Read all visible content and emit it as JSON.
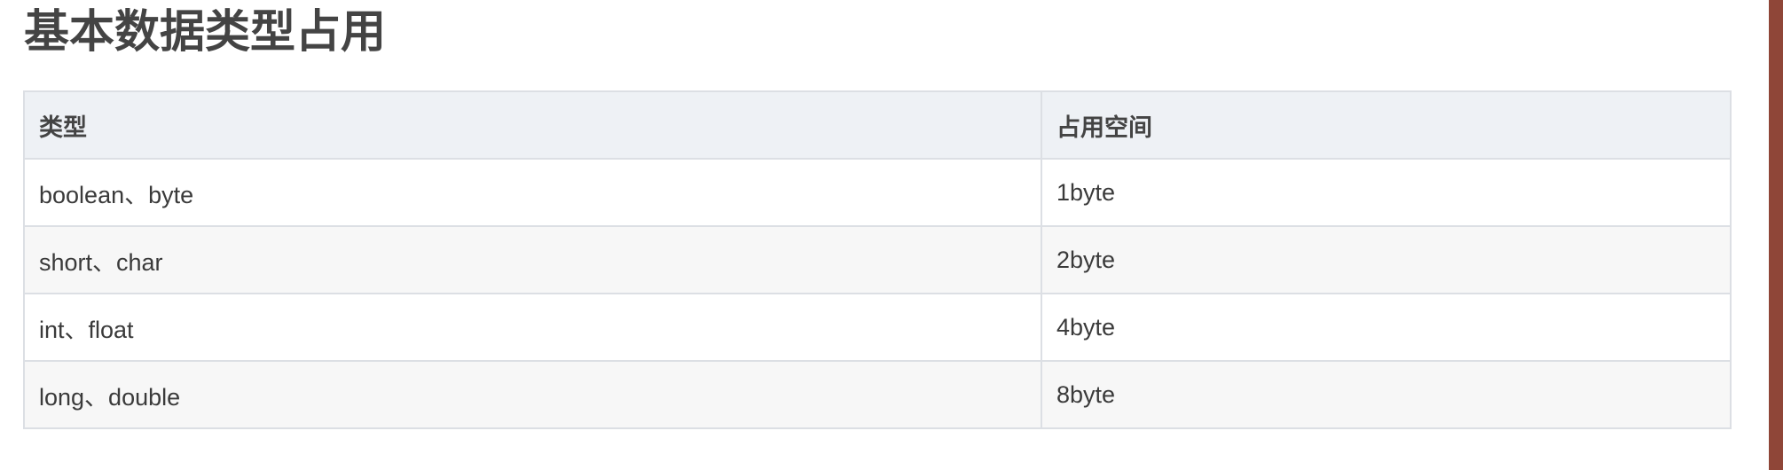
{
  "page": {
    "title": "基本数据类型占用"
  },
  "table": {
    "headers": [
      "类型",
      "占用空间"
    ],
    "rows": [
      [
        "boolean、byte",
        "1byte"
      ],
      [
        "short、char",
        "2byte"
      ],
      [
        "int、float",
        "4byte"
      ],
      [
        "long、double",
        "8byte"
      ]
    ]
  },
  "colors": {
    "accent_bar": "#8f4638",
    "header_bg": "#eef1f5",
    "stripe_bg": "#f7f7f7",
    "border": "#dcdfe4"
  }
}
